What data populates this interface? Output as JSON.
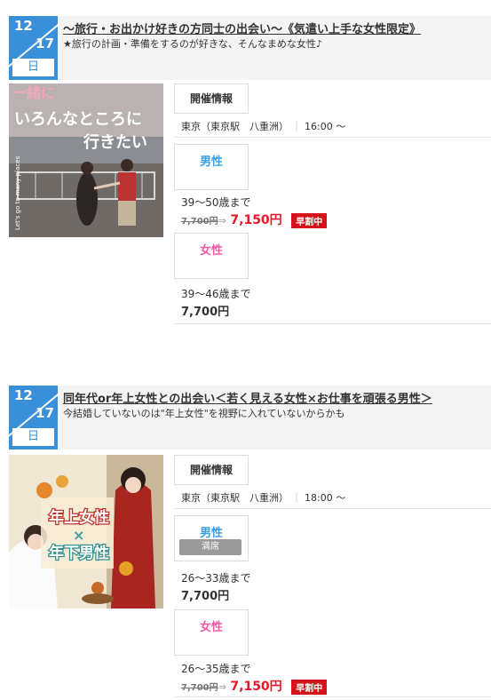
{
  "events": [
    {
      "date": {
        "month": "12",
        "day": "17",
        "weekday": "日"
      },
      "title": "〜旅行・お出かけ好きの方同士の出会い〜《気遣い上手な女性限定》",
      "subtitle": "★旅行の計画・準備をするのが好きな、そんなまめな女性♪",
      "photo_text": {
        "line1": "一緒に",
        "line2": "いろんなところに",
        "line3": "行きたい",
        "side": "Let's go to many places"
      },
      "info_label": "開催情報",
      "venue": "東京（東京駅　八重洲）",
      "time": "16:00 〜",
      "male": {
        "label": "男性",
        "status": "",
        "age": "39〜50歳まで",
        "old_price": "7,700円",
        "arrow": "⇒",
        "price": "7,150円",
        "badge": "早割中"
      },
      "female": {
        "label": "女性",
        "status": "",
        "age": "39〜46歳まで",
        "old_price": "",
        "arrow": "",
        "price": "7,700円",
        "badge": ""
      }
    },
    {
      "date": {
        "month": "12",
        "day": "17",
        "weekday": "日"
      },
      "title": "同年代or年上女性との出会い＜若く見える女性×お仕事を頑張る男性＞",
      "subtitle": "今結婚していないのは\"年上女性\"を視野に入れていないからかも",
      "photo_text": {
        "line1": "年上女性",
        "line2": "×",
        "line3": "年下男性",
        "side": ""
      },
      "info_label": "開催情報",
      "venue": "東京（東京駅　八重洲）",
      "time": "18:00 〜",
      "male": {
        "label": "男性",
        "status": "満席",
        "age": "26〜33歳まで",
        "old_price": "",
        "arrow": "",
        "price": "7,700円",
        "badge": ""
      },
      "female": {
        "label": "女性",
        "status": "",
        "age": "26〜35歳まで",
        "old_price": "7,700円",
        "arrow": "⇒",
        "price": "7,150円",
        "badge": "早割中"
      }
    }
  ],
  "colors": {
    "date_bg": "#3a8fd9",
    "male": "#3a9ee4",
    "female": "#ef5aa6",
    "sale": "#e8162a",
    "badge_bg": "#d6131b"
  }
}
